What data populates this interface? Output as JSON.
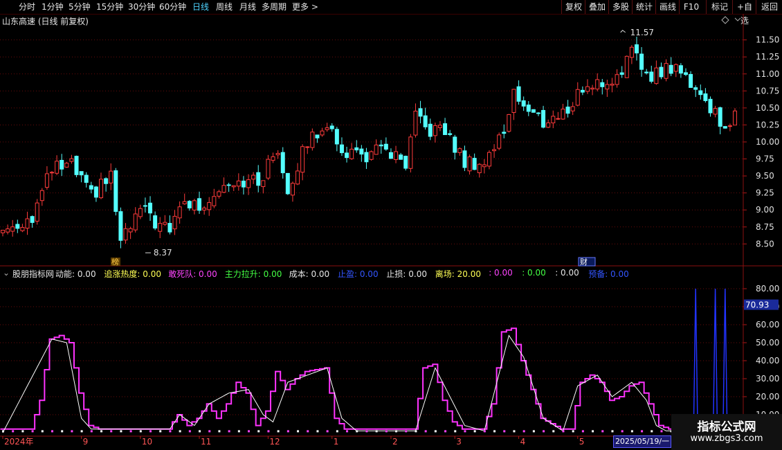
{
  "toolbar": {
    "left": [
      "分时",
      "1分钟",
      "5分钟",
      "15分钟",
      "30分钟",
      "60分钟",
      "日线",
      "周线",
      "月线",
      "多周期",
      "更多 >"
    ],
    "active_index": 6,
    "right": [
      "复权",
      "叠加",
      "多股",
      "统计",
      "画线",
      "F10",
      "+自选",
      "返回"
    ],
    "mark": "标记"
  },
  "chart": {
    "title": "山东高速 (日线 前复权)",
    "high_label": "11.57",
    "low_label": "8.37",
    "mark_bang": "榜",
    "mark_caihui": "财",
    "price_ticks": [
      "11.50",
      "11.25",
      "11.00",
      "10.75",
      "10.50",
      "10.25",
      "10.00",
      "9.75",
      "9.50",
      "9.25",
      "9.00",
      "8.75",
      "8.50"
    ],
    "price_range": [
      8.3,
      11.7
    ]
  },
  "indicator": {
    "name": "股朋指标网",
    "items": [
      {
        "label": "动能:",
        "value": "0.00",
        "color": "#e6e6e6"
      },
      {
        "label": "追涨热度:",
        "value": "0.00",
        "color": "#ffff55"
      },
      {
        "label": "敢死队:",
        "value": "0.00",
        "color": "#ff44ff"
      },
      {
        "label": "主力拉升:",
        "value": "0.00",
        "color": "#44ff44"
      },
      {
        "label": "成本:",
        "value": "0.00",
        "color": "#e6e6e6"
      },
      {
        "label": "止盈:",
        "value": "0.00",
        "color": "#3355ff"
      },
      {
        "label": "止损:",
        "value": "0.00",
        "color": "#e6e6e6"
      },
      {
        "label": "离场:",
        "value": "20.00",
        "color": "#ffff55"
      },
      {
        "label": ":",
        "value": "0.00",
        "color": "#ff44ff"
      },
      {
        "label": ":",
        "value": "0.00",
        "color": "#44ff44"
      },
      {
        "label": ":",
        "value": "0.00",
        "color": "#e6e6e6"
      },
      {
        "label": "预备:",
        "value": "0.00",
        "color": "#3355ff"
      }
    ],
    "ticks": [
      "80.00",
      "70.00",
      "60.00",
      "50.00",
      "40.00",
      "30.00",
      "20.00",
      "10.00"
    ],
    "current_value": "70.93",
    "range": [
      0,
      85
    ]
  },
  "x_axis": {
    "labels": [
      {
        "text": "2024年",
        "i": 0
      },
      {
        "text": "9",
        "i": 16
      },
      {
        "text": "10",
        "i": 28
      },
      {
        "text": "11",
        "i": 40
      },
      {
        "text": "12",
        "i": 54
      },
      {
        "text": "1",
        "i": 67
      },
      {
        "text": "2",
        "i": 79
      },
      {
        "text": "3",
        "i": 92
      },
      {
        "text": "4",
        "i": 105
      },
      {
        "text": "5",
        "i": 117
      }
    ],
    "cursor_date": "2025/05/19/一"
  },
  "watermark": {
    "line1": "指标公式网",
    "line2": "www.zbgs3.com"
  },
  "chart_data": {
    "type": "candlestick",
    "count": 150,
    "close_keypoints": [
      [
        0,
        8.7
      ],
      [
        6,
        8.9
      ],
      [
        10,
        9.6
      ],
      [
        14,
        9.65
      ],
      [
        18,
        9.2
      ],
      [
        22,
        9.5
      ],
      [
        24,
        8.5
      ],
      [
        28,
        9.0
      ],
      [
        30,
        8.9
      ],
      [
        34,
        8.65
      ],
      [
        36,
        9.1
      ],
      [
        40,
        9.05
      ],
      [
        46,
        9.45
      ],
      [
        52,
        9.4
      ],
      [
        56,
        9.9
      ],
      [
        58,
        9.3
      ],
      [
        62,
        10.0
      ],
      [
        66,
        10.3
      ],
      [
        68,
        9.9
      ],
      [
        74,
        9.8
      ],
      [
        78,
        9.9
      ],
      [
        82,
        9.6
      ],
      [
        84,
        10.35
      ],
      [
        86,
        10.2
      ],
      [
        90,
        10.15
      ],
      [
        94,
        9.7
      ],
      [
        98,
        9.7
      ],
      [
        102,
        10.15
      ],
      [
        104,
        10.8
      ],
      [
        106,
        10.5
      ],
      [
        110,
        10.3
      ],
      [
        114,
        10.4
      ],
      [
        118,
        10.8
      ],
      [
        124,
        10.9
      ],
      [
        128,
        11.3
      ],
      [
        130,
        11.1
      ],
      [
        132,
        11.0
      ],
      [
        136,
        11.1
      ],
      [
        140,
        10.9
      ],
      [
        144,
        10.5
      ],
      [
        147,
        10.25
      ],
      [
        149,
        10.35
      ]
    ],
    "high": 11.57,
    "low": 8.37,
    "osc_purple_keypoints": [
      [
        0,
        2
      ],
      [
        6,
        2
      ],
      [
        8,
        18
      ],
      [
        10,
        52
      ],
      [
        12,
        54
      ],
      [
        14,
        50
      ],
      [
        16,
        22
      ],
      [
        18,
        4
      ],
      [
        20,
        2
      ],
      [
        34,
        2
      ],
      [
        36,
        10
      ],
      [
        38,
        4
      ],
      [
        40,
        8
      ],
      [
        42,
        16
      ],
      [
        44,
        8
      ],
      [
        46,
        16
      ],
      [
        48,
        28
      ],
      [
        50,
        22
      ],
      [
        52,
        4
      ],
      [
        54,
        12
      ],
      [
        56,
        34
      ],
      [
        58,
        24
      ],
      [
        60,
        30
      ],
      [
        62,
        34
      ],
      [
        66,
        36
      ],
      [
        68,
        8
      ],
      [
        70,
        2
      ],
      [
        84,
        2
      ],
      [
        86,
        36
      ],
      [
        88,
        38
      ],
      [
        90,
        18
      ],
      [
        92,
        6
      ],
      [
        94,
        2
      ],
      [
        98,
        2
      ],
      [
        100,
        16
      ],
      [
        102,
        56
      ],
      [
        104,
        58
      ],
      [
        106,
        40
      ],
      [
        110,
        8
      ],
      [
        114,
        2
      ],
      [
        116,
        2
      ],
      [
        118,
        28
      ],
      [
        120,
        32
      ],
      [
        122,
        28
      ],
      [
        124,
        18
      ],
      [
        126,
        20
      ],
      [
        128,
        26
      ],
      [
        130,
        28
      ],
      [
        132,
        16
      ],
      [
        134,
        4
      ],
      [
        136,
        2
      ],
      [
        149,
        2
      ]
    ],
    "osc_white_keypoints": [
      [
        0,
        0
      ],
      [
        10,
        52
      ],
      [
        13,
        50
      ],
      [
        16,
        8
      ],
      [
        18,
        2
      ],
      [
        34,
        2
      ],
      [
        36,
        10
      ],
      [
        39,
        4
      ],
      [
        42,
        16
      ],
      [
        46,
        22
      ],
      [
        50,
        24
      ],
      [
        53,
        10
      ],
      [
        55,
        6
      ],
      [
        58,
        28
      ],
      [
        62,
        32
      ],
      [
        66,
        36
      ],
      [
        69,
        8
      ],
      [
        72,
        1
      ],
      [
        84,
        1
      ],
      [
        88,
        36
      ],
      [
        91,
        20
      ],
      [
        94,
        4
      ],
      [
        98,
        1
      ],
      [
        103,
        54
      ],
      [
        106,
        42
      ],
      [
        110,
        8
      ],
      [
        114,
        1
      ],
      [
        117,
        26
      ],
      [
        121,
        32
      ],
      [
        124,
        20
      ],
      [
        128,
        28
      ],
      [
        131,
        18
      ],
      [
        133,
        4
      ],
      [
        135,
        1
      ],
      [
        149,
        1
      ]
    ],
    "blue_spikes": [
      141,
      145,
      147
    ]
  }
}
